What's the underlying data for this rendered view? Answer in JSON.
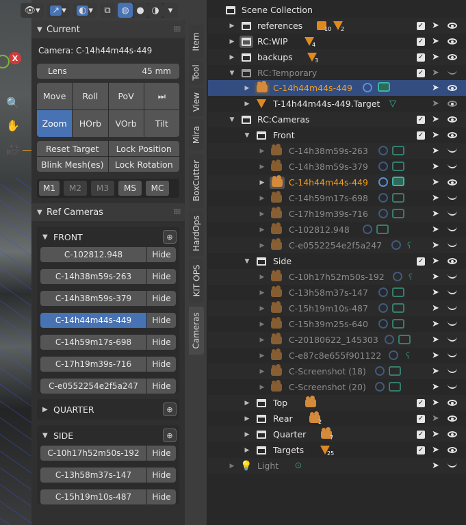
{
  "npanel": {
    "current": {
      "header": "Current",
      "camera_label": "Camera: C-14h44m44s-449",
      "lens_label": "Lens",
      "lens_value": "45 mm",
      "nav_buttons": [
        "Move",
        "Roll",
        "PoV",
        "⏭",
        "Zoom",
        "HOrb",
        "VOrb",
        "Tilt"
      ],
      "action_buttons": [
        "Reset Target",
        "Lock Position",
        "Blink Mesh(es)",
        "Lock Rotation"
      ],
      "m_buttons": [
        "M1",
        "M2",
        "M3",
        "MS",
        "MC"
      ]
    },
    "ref_cameras": {
      "header": "Ref Cameras",
      "front_label": "FRONT",
      "front": [
        "C-102812.948",
        "C-14h38m59s-263",
        "C-14h38m59s-379",
        "C-14h44m44s-449",
        "C-14h59m17s-698",
        "C-17h19m39s-716",
        "C-e0552254e2f5a247"
      ],
      "hide_label": "Hide",
      "quarter_label": "QUARTER",
      "side_label": "SIDE",
      "side": [
        "C-10h17h52m50s-192",
        "C-13h58m37s-147",
        "C-15h19m10s-487"
      ]
    }
  },
  "tabs": [
    "Item",
    "Tool",
    "View",
    "Mira",
    "BoxCutter",
    "HardOps",
    "KIT OPS",
    "Cameras"
  ],
  "outliner": {
    "rows": [
      {
        "name": "Scene Collection"
      },
      {
        "name": "references",
        "badge1": "10",
        "badge2": "2"
      },
      {
        "name": "RC:WIP",
        "badge1": "4"
      },
      {
        "name": "backups",
        "badge1": "3"
      },
      {
        "name": "RC:Temporary"
      },
      {
        "name": "C-14h44m44s-449"
      },
      {
        "name": "T-14h44m44s-449.Target"
      },
      {
        "name": "RC:Cameras"
      },
      {
        "name": "Front"
      },
      {
        "name": "C-14h38m59s-263"
      },
      {
        "name": "C-14h38m59s-379"
      },
      {
        "name": "C-14h44m44s-449"
      },
      {
        "name": "C-14h59m17s-698"
      },
      {
        "name": "C-17h19m39s-716"
      },
      {
        "name": "C-102812.948"
      },
      {
        "name": "C-e0552254e2f5a247"
      },
      {
        "name": "Side"
      },
      {
        "name": "C-10h17h52m50s-192"
      },
      {
        "name": "C-13h58m37s-147"
      },
      {
        "name": "C-15h19m10s-487"
      },
      {
        "name": "C-15h39m25s-640"
      },
      {
        "name": "C-20180622_145303"
      },
      {
        "name": "C-e87c8e655f901122"
      },
      {
        "name": "C-Screenshot (18)"
      },
      {
        "name": "C-Screenshot (20)"
      },
      {
        "name": "Top"
      },
      {
        "name": "Rear",
        "badge1": "2"
      },
      {
        "name": "Quarter",
        "badge1": "7"
      },
      {
        "name": "Targets",
        "badge1": "25"
      },
      {
        "name": "Light"
      }
    ]
  },
  "colors": {
    "accent_blue": "#4772b3",
    "active_orange": "#f0a020",
    "selected_row": "#334d80"
  }
}
